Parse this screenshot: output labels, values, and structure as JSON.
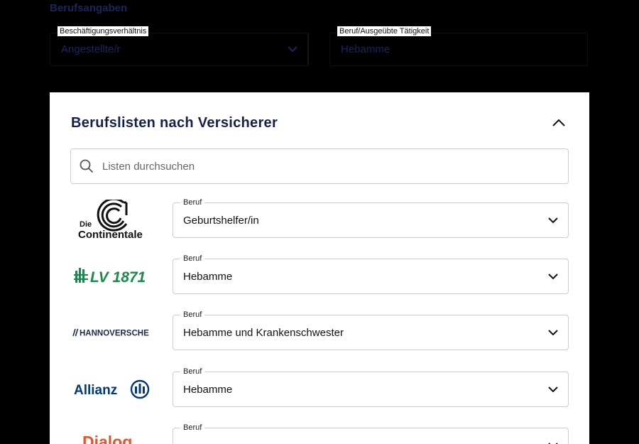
{
  "background_form": {
    "heading": "Berufsangaben",
    "employment": {
      "label": "Beschäftigungsverhältnis",
      "value": "Angestellte/r"
    },
    "occupation": {
      "label": "Beruf/Ausgeübte Tätigkeit",
      "value": "Hebamme"
    }
  },
  "panel": {
    "title": "Berufslisten nach Versicherer",
    "search_placeholder": "Listen durchsuchen",
    "field_label": "Beruf",
    "insurers": [
      {
        "logo_line1": "Die",
        "logo_line2": "Continentale",
        "value": "Geburtshelfer/in"
      },
      {
        "logo_text": "LV 1871",
        "value": "Hebamme"
      },
      {
        "logo_text": "HANNOVERSCHE",
        "value": "Hebamme und Krankenschwester"
      },
      {
        "logo_text": "Allianz",
        "value": "Hebamme"
      },
      {
        "logo_text": "Dialog",
        "value": ""
      }
    ]
  },
  "colors": {
    "navy": "#15204a",
    "continentale_black": "#111111",
    "lv_green": "#1a8a4a",
    "hannoversche_navy": "#1c2a4e",
    "allianz_blue": "#003781",
    "dialog_orange": "#e2572a",
    "border": "#c9ccd3"
  },
  "icons": [
    "chevron-down-icon",
    "chevron-up-icon",
    "search-icon"
  ]
}
